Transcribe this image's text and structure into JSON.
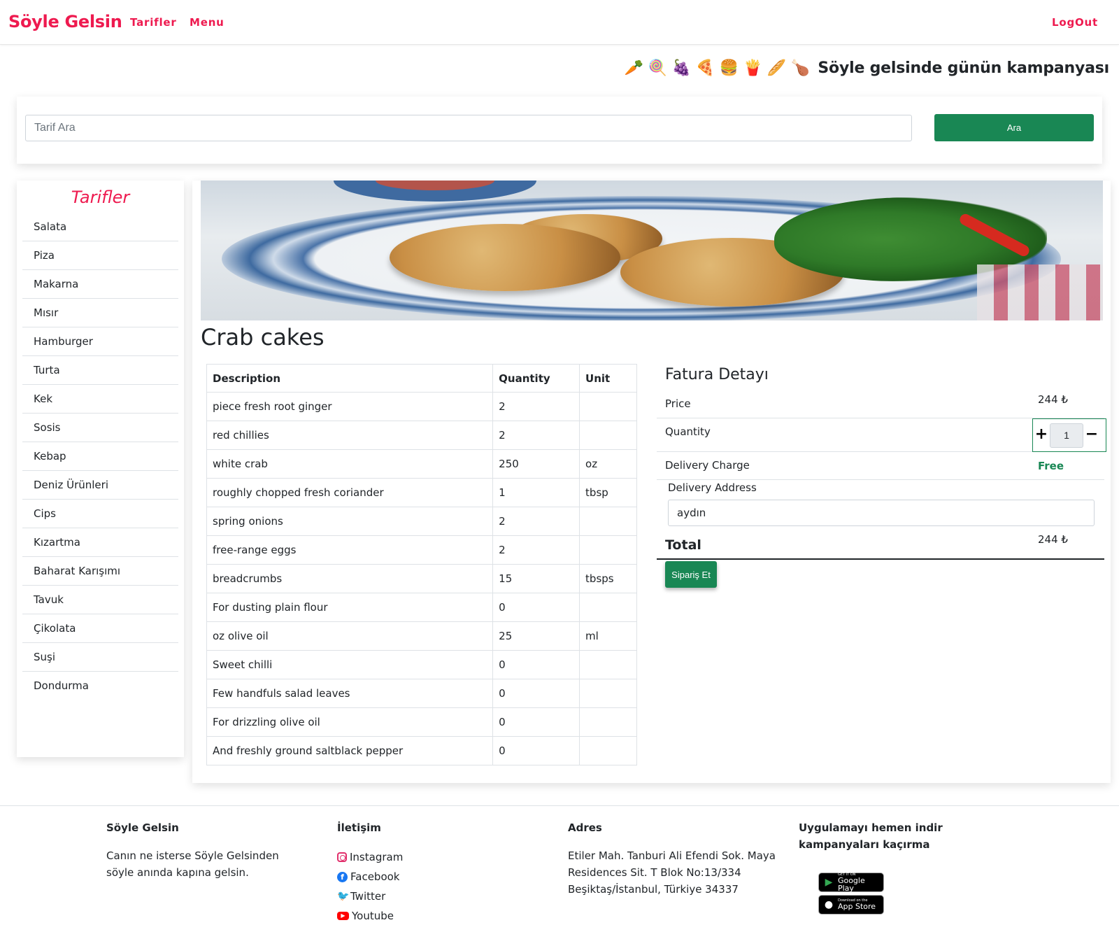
{
  "navbar": {
    "brand": "Söyle Gelsin",
    "links": [
      "Tarifler",
      "Menu"
    ],
    "logout": "LogOut"
  },
  "campaign": {
    "emojis": [
      "🥕",
      "🍭",
      "🍇",
      "🍕",
      "🍔",
      "🍟",
      "🥖",
      "🍗"
    ],
    "text": "Söyle gelsinde günün kampanyası"
  },
  "search": {
    "placeholder": "Tarif Ara",
    "button": "Ara"
  },
  "sidebar": {
    "title": "Tarifler",
    "items": [
      "Salata",
      "Piza",
      "Makarna",
      "Mısır",
      "Hamburger",
      "Turta",
      "Kek",
      "Sosis",
      "Kebap",
      "Deniz Ürünleri",
      "Cips",
      "Kızartma",
      "Baharat Karışımı",
      "Tavuk",
      "Çikolata",
      "Suşi",
      "Dondurma"
    ]
  },
  "recipe": {
    "title": "Crab cakes",
    "table": {
      "headers": [
        "Description",
        "Quantity",
        "Unit"
      ],
      "rows": [
        [
          "piece fresh root ginger",
          "2",
          ""
        ],
        [
          "red chillies",
          "2",
          ""
        ],
        [
          "white crab",
          "250",
          "oz"
        ],
        [
          "roughly chopped fresh coriander",
          "1",
          "tbsp"
        ],
        [
          "spring onions",
          "2",
          ""
        ],
        [
          "free-range eggs",
          "2",
          ""
        ],
        [
          "breadcrumbs",
          "15",
          "tbsps"
        ],
        [
          "For dusting plain flour",
          "0",
          ""
        ],
        [
          "oz olive oil",
          "25",
          "ml"
        ],
        [
          "Sweet chilli",
          "0",
          ""
        ],
        [
          "Few handfuls salad leaves",
          "0",
          ""
        ],
        [
          "For drizzling olive oil",
          "0",
          ""
        ],
        [
          "And freshly ground saltblack pepper",
          "0",
          ""
        ]
      ]
    }
  },
  "invoice": {
    "title": "Fatura Detayı",
    "price_label": "Price",
    "price_value": "244 ₺",
    "quantity_label": "Quantity",
    "quantity_value": "1",
    "plus": "+",
    "minus": "−",
    "delivery_label": "Delivery Charge",
    "delivery_value": "Free",
    "address_label": "Delivery Address",
    "address_value": "aydın",
    "total_label": "Total",
    "total_value": "244 ₺",
    "order_button": "Sipariş Et"
  },
  "footer": {
    "col1": {
      "heading": "Söyle Gelsin",
      "text": "Canın ne isterse Söyle Gelsinden söyle anında kapına gelsin."
    },
    "col2": {
      "heading": "İletişim",
      "links": [
        "Instagram",
        "Facebook",
        "Twitter",
        "Youtube"
      ]
    },
    "col3": {
      "heading": "Adres",
      "text": "Etiler Mah. Tanburi Ali Efendi Sok. Maya Residences Sit. T Blok No:13/334 Beşiktaş/İstanbul, Türkiye 34337"
    },
    "col4": {
      "heading": "Uygulamayı hemen indir kampanyaları kaçırma",
      "badges": [
        {
          "small": "GET IT ON",
          "big": "Google Play"
        },
        {
          "small": "Download on the",
          "big": "App Store"
        }
      ]
    }
  },
  "colors": {
    "brand": "#ee1a4f",
    "primary_green": "#198754"
  }
}
